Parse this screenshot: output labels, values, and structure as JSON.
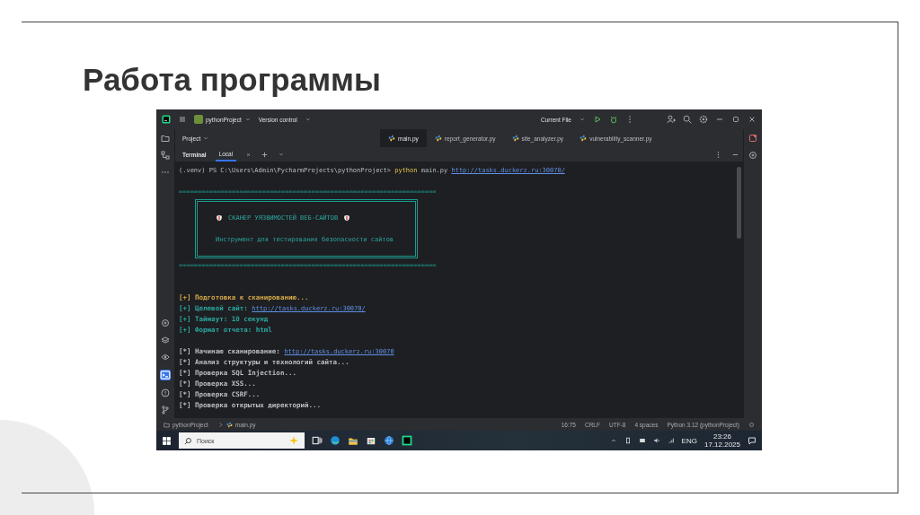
{
  "slide": {
    "title": "Работа программы"
  },
  "ide": {
    "title_bar": {
      "project": "pythonProject",
      "vcs": "Version control",
      "run_config": "Current File"
    },
    "project_label": "Project",
    "editor_tabs": [
      {
        "label": "main.py",
        "selected": true
      },
      {
        "label": "report_generator.py",
        "selected": false
      },
      {
        "label": "site_analyzer.py",
        "selected": false
      },
      {
        "label": "vulnerability_scanner.py",
        "selected": false
      }
    ],
    "terminal": {
      "title": "Terminal",
      "tabs": [
        {
          "label": "Local",
          "selected": true
        }
      ],
      "lines": [
        {
          "kind": "prompt",
          "path": "(.venv) PS C:\\Users\\Admin\\PycharmProjects\\pythonProject>",
          "command": "python",
          "args": "main.py",
          "link": "http://tasks.duckerz.ru:30070/"
        },
        {
          "kind": "blank"
        },
        {
          "kind": "separator",
          "text": "===================================================================="
        },
        {
          "kind": "banner",
          "title": "СКАНЕР УЯЗВИМОСТЕЙ ВЕБ-САЙТОВ",
          "subtitle": "Инструмент для тестирования безопасности сайтов"
        },
        {
          "kind": "separator",
          "text": "===================================================================="
        },
        {
          "kind": "blank"
        },
        {
          "kind": "blank"
        },
        {
          "kind": "log",
          "color": "#d6a94a",
          "text": "[+] Подготовка к сканированию..."
        },
        {
          "kind": "log",
          "color": "#2aa6a0",
          "text": "[+] Целевой сайт: ",
          "link": "http://tasks.duckerz.ru:30070/"
        },
        {
          "kind": "log",
          "color": "#2aa6a0",
          "text": "[+] Таймаут: 10 секунд"
        },
        {
          "kind": "log",
          "color": "#2aa6a0",
          "text": "[+] Формат отчета: html"
        },
        {
          "kind": "blank"
        },
        {
          "kind": "log",
          "color": "#bcbec4",
          "text": "[*] Начинаю сканирование: ",
          "link": "http://tasks.duckerz.ru:30070"
        },
        {
          "kind": "log",
          "color": "#bcbec4",
          "text": "[*] Анализ структуры и технологий сайта..."
        },
        {
          "kind": "log",
          "color": "#bcbec4",
          "text": "[*] Проверка SQL Injection..."
        },
        {
          "kind": "log",
          "color": "#bcbec4",
          "text": "[*] Проверка XSS..."
        },
        {
          "kind": "log",
          "color": "#bcbec4",
          "text": "[*] Проверка CSRF..."
        },
        {
          "kind": "log",
          "color": "#bcbec4",
          "text": "[*] Проверка открытых директорий..."
        }
      ]
    },
    "breadcrumbs": [
      "pythonProject",
      "main.py"
    ],
    "status_items": [
      "16:75",
      "CRLF",
      "UTF-8",
      "4 spaces",
      "Python 3.12 (pythonProject)"
    ]
  },
  "taskbar": {
    "search_placeholder": "Поиск",
    "language": "ENG",
    "time": "23:26",
    "date": "17.12.2025"
  }
}
